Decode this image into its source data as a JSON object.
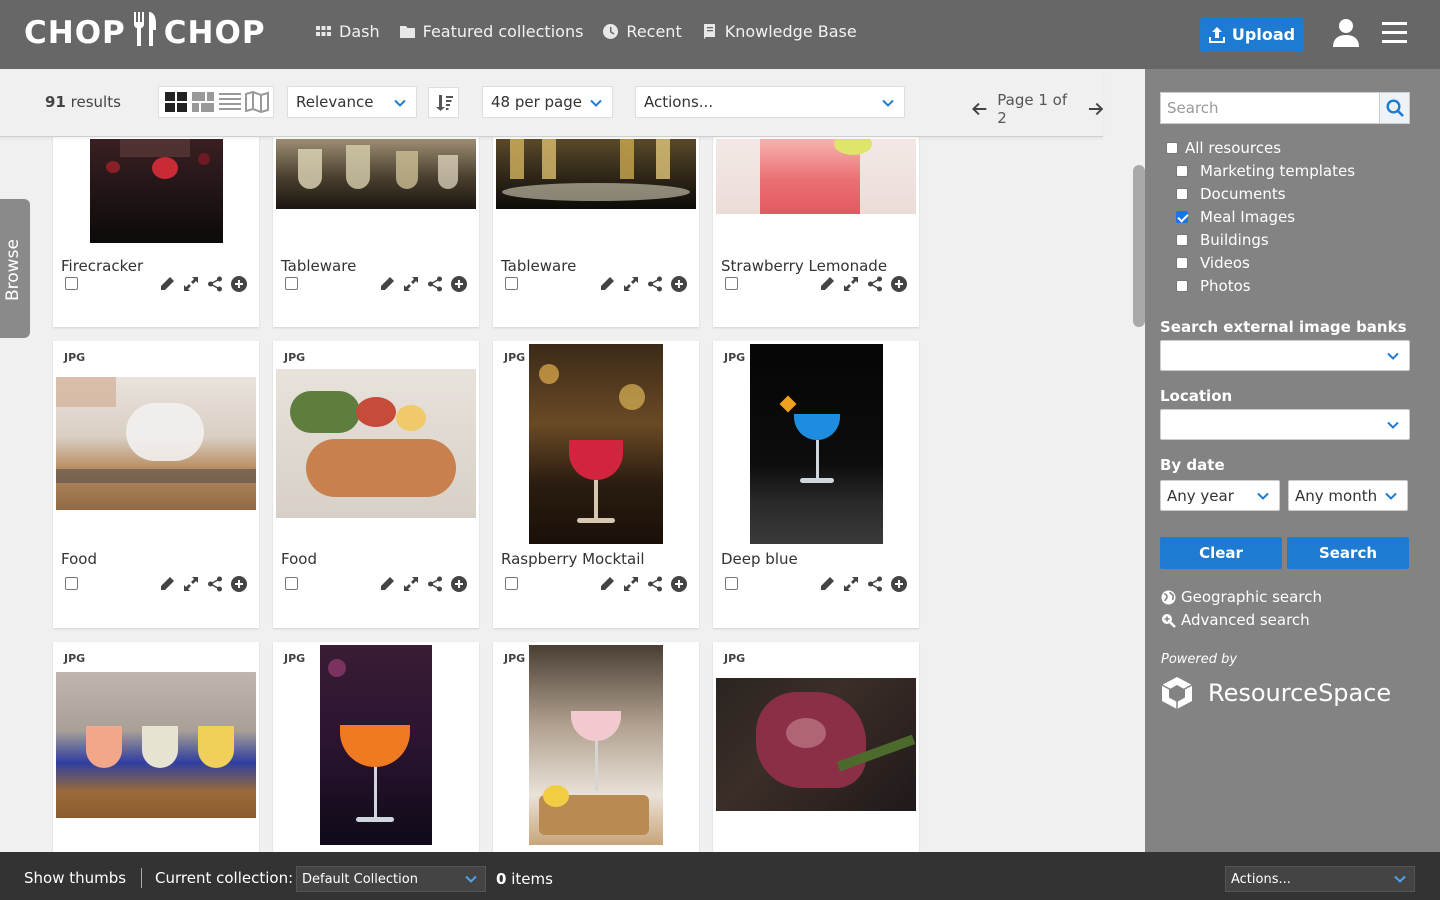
{
  "header": {
    "logo_left": "CHOP",
    "logo_right": "CHOP",
    "nav": [
      {
        "label": "Dash",
        "icon": "grid-icon"
      },
      {
        "label": "Featured collections",
        "icon": "folder-icon"
      },
      {
        "label": "Recent",
        "icon": "clock-icon"
      },
      {
        "label": "Knowledge Base",
        "icon": "book-icon"
      }
    ],
    "upload_label": "Upload"
  },
  "toolbar": {
    "results_count": "91",
    "results_label": "results",
    "sort_by": "Relevance",
    "per_page": "48 per page",
    "actions": "Actions...",
    "page_info": "Page 1 of 2"
  },
  "browse_label": "Browse",
  "cards": [
    {
      "title": "Firecracker",
      "type": ""
    },
    {
      "title": "Tableware",
      "type": ""
    },
    {
      "title": "Tableware",
      "type": ""
    },
    {
      "title": "Strawberry Lemonade",
      "type": ""
    },
    {
      "title": "Food",
      "type": "JPG"
    },
    {
      "title": "Food",
      "type": "JPG"
    },
    {
      "title": "Raspberry Mocktail",
      "type": "JPG"
    },
    {
      "title": "Deep blue",
      "type": "JPG"
    },
    {
      "title": "",
      "type": "JPG"
    },
    {
      "title": "",
      "type": "JPG"
    },
    {
      "title": "",
      "type": "JPG"
    },
    {
      "title": "",
      "type": "JPG"
    }
  ],
  "sidebar": {
    "search_placeholder": "Search",
    "resource_types": [
      {
        "label": "All resources",
        "checked": false
      },
      {
        "label": "Marketing templates",
        "checked": false
      },
      {
        "label": "Documents",
        "checked": false
      },
      {
        "label": "Meal Images",
        "checked": true
      },
      {
        "label": "Buildings",
        "checked": false
      },
      {
        "label": "Videos",
        "checked": false
      },
      {
        "label": "Photos",
        "checked": false
      }
    ],
    "external_label": "Search external image banks",
    "external_value": "",
    "location_label": "Location",
    "location_value": "",
    "date_label": "By date",
    "year_value": "Any year",
    "month_value": "Any month",
    "clear_label": "Clear",
    "search_label": "Search",
    "geo_link": "Geographic search",
    "advanced_link": "Advanced search",
    "powered_by": "Powered by",
    "brand": "ResourceSpace"
  },
  "footer": {
    "show_thumbs": "Show thumbs",
    "current_collection_label": "Current collection:",
    "collection_value": "Default Collection",
    "items_count": "0",
    "items_label": "items",
    "actions": "Actions..."
  },
  "colors": {
    "header_bg": "#676767",
    "sidebar_bg": "#838383",
    "accent_blue": "#1f7bd1",
    "footer_bg": "#333333"
  }
}
